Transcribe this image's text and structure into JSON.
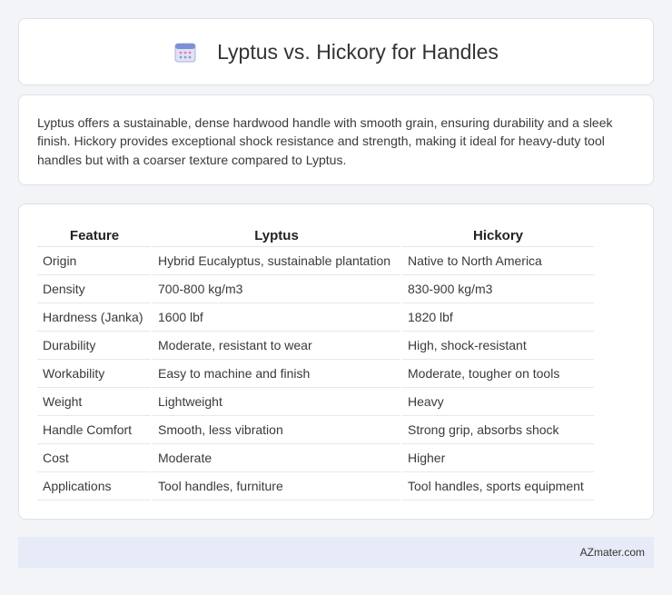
{
  "header": {
    "title": "Lyptus vs. Hickory for Handles",
    "icon": "calendar-icon"
  },
  "intro": {
    "text": "Lyptus offers a sustainable, dense hardwood handle with smooth grain, ensuring durability and a sleek finish. Hickory provides exceptional shock resistance and strength, making it ideal for heavy-duty tool handles but with a coarser texture compared to Lyptus."
  },
  "table": {
    "headers": [
      "Feature",
      "Lyptus",
      "Hickory"
    ],
    "rows": [
      [
        "Origin",
        "Hybrid Eucalyptus, sustainable plantation",
        "Native to North America"
      ],
      [
        "Density",
        "700-800 kg/m3",
        "830-900 kg/m3"
      ],
      [
        "Hardness (Janka)",
        "1600 lbf",
        "1820 lbf"
      ],
      [
        "Durability",
        "Moderate, resistant to wear",
        "High, shock-resistant"
      ],
      [
        "Workability",
        "Easy to machine and finish",
        "Moderate, tougher on tools"
      ],
      [
        "Weight",
        "Lightweight",
        "Heavy"
      ],
      [
        "Handle Comfort",
        "Smooth, less vibration",
        "Strong grip, absorbs shock"
      ],
      [
        "Cost",
        "Moderate",
        "Higher"
      ],
      [
        "Applications",
        "Tool handles, furniture",
        "Tool handles, sports equipment"
      ]
    ]
  },
  "footer": {
    "text": "AZmater.com"
  }
}
